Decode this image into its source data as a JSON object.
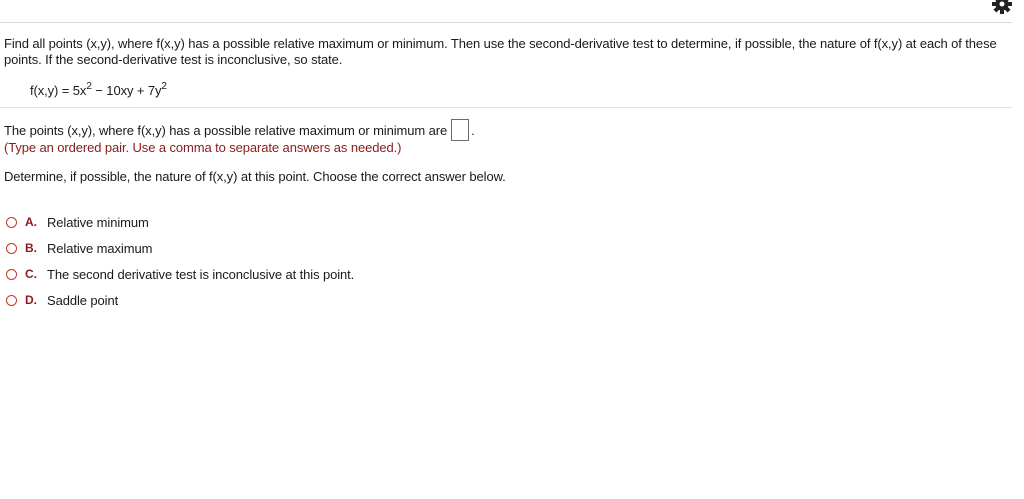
{
  "header": {
    "settings_icon": "gear-icon"
  },
  "question": {
    "text": "Find all points (x,y), where f(x,y) has a possible relative maximum or minimum. Then use the second-derivative test to determine, if possible, the nature of f(x,y) at each of these points. If the second-derivative test is inconclusive, so state.",
    "function_prefix": "f(x,y) = 5x",
    "exp1": "2",
    "function_middle": " − 10xy + 7y",
    "exp2": "2"
  },
  "part1": {
    "prompt": "The points (x,y), where f(x,y) has a possible relative maximum or minimum are",
    "answer_value": "",
    "trailing": ".",
    "hint": "(Type an ordered pair. Use a comma to separate answers as needed.)"
  },
  "part2": {
    "prompt": "Determine, if possible, the nature of f(x,y) at this point. Choose the correct answer below.",
    "options": [
      {
        "letter": "A.",
        "label": "Relative minimum"
      },
      {
        "letter": "B.",
        "label": "Relative maximum"
      },
      {
        "letter": "C.",
        "label": "The second derivative test is inconclusive at this point."
      },
      {
        "letter": "D.",
        "label": "Saddle point"
      }
    ]
  },
  "colors": {
    "accent_red": "#c0392b",
    "hint_text": "#8b1a1a"
  }
}
